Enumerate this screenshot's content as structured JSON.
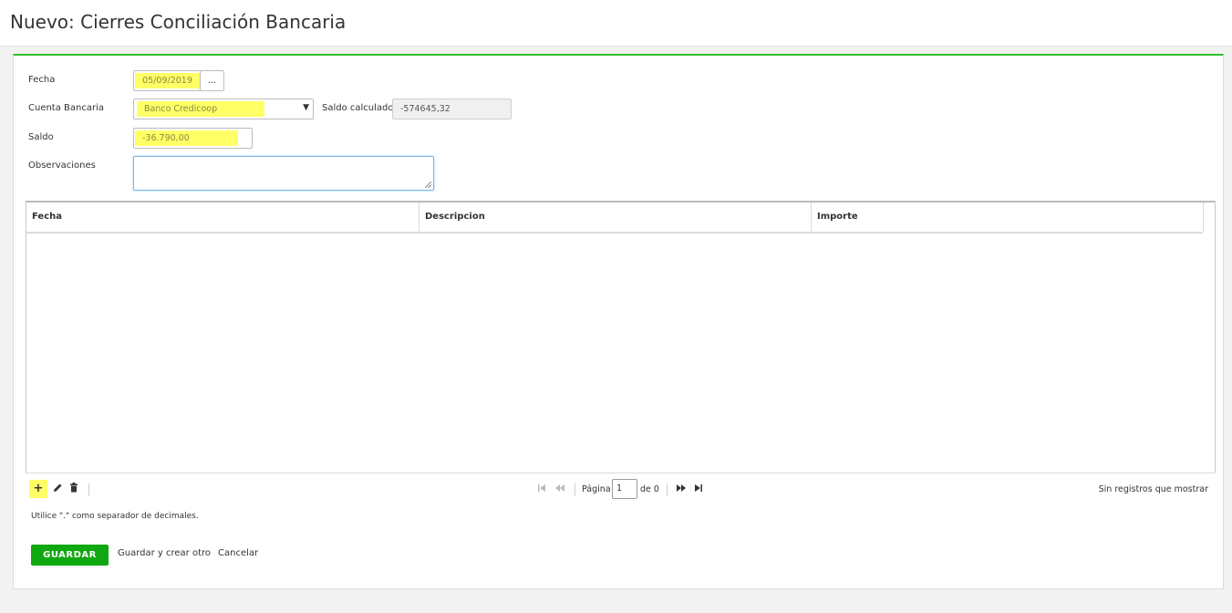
{
  "page": {
    "title": "Nuevo: Cierres Conciliación Bancaria"
  },
  "form": {
    "fecha_label": "Fecha",
    "fecha_value": "05/09/2019",
    "fecha_button": "...",
    "cuenta_label": "Cuenta Bancaria",
    "cuenta_value": "Banco Credicoop",
    "saldo_calc_label": "Saldo calculado",
    "saldo_calc_value": "-574645,32",
    "saldo_label": "Saldo",
    "saldo_value": "-36.790,00",
    "obs_label": "Observaciones",
    "obs_value": ""
  },
  "grid": {
    "columns": [
      "Fecha",
      "Descripcion",
      "Importe"
    ],
    "rows": []
  },
  "pager": {
    "page_label": "Página",
    "page_value": "1",
    "of_label": "de 0",
    "status": "Sin registros que mostrar"
  },
  "note": "Utilice \".\" como separador de decimales.",
  "actions": {
    "save": "GUARDAR",
    "save_new": "Guardar y crear otro",
    "cancel": "Cancelar"
  },
  "colors": {
    "accent": "#2fc12f",
    "save_button": "#10a810",
    "highlight": "#ffff66"
  }
}
